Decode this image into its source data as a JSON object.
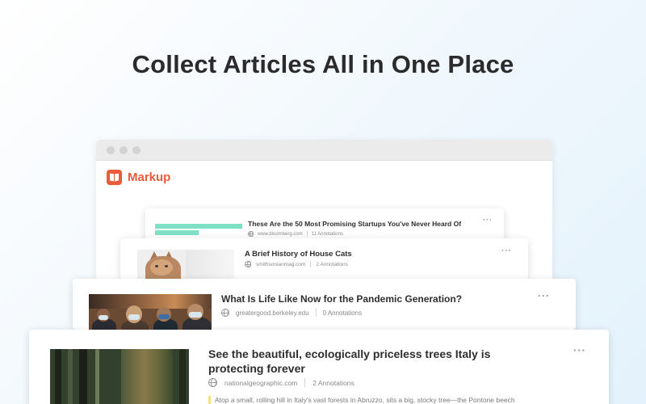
{
  "headline": "Collect Articles All in One Place",
  "app": {
    "brand_name": "Markup",
    "brand_color": "#ea5b3a"
  },
  "articles": [
    {
      "title": "These Are the 50 Most Promising Startups You've Never Heard Of",
      "source": "www.bloomberg.com",
      "annotations": "11 Annotations"
    },
    {
      "title": "A Brief History of House Cats",
      "source": "smithsonianmag.com",
      "annotations": "2 Annotations"
    },
    {
      "title": "What Is Life Like Now for the Pandemic Generation?",
      "source": "greatergood.berkeley.edu",
      "annotations": "0 Annotations"
    },
    {
      "title": "See the beautiful, ecologically priceless trees Italy is protecting forever",
      "source": "nationalgeographic.com",
      "annotations": "2 Annotations",
      "excerpt": "Atop a small, rolling hill in Italy's vast forests in Abruzzo, sits a big, stocky tree—the Pontone beech"
    }
  ],
  "more_label": "···"
}
